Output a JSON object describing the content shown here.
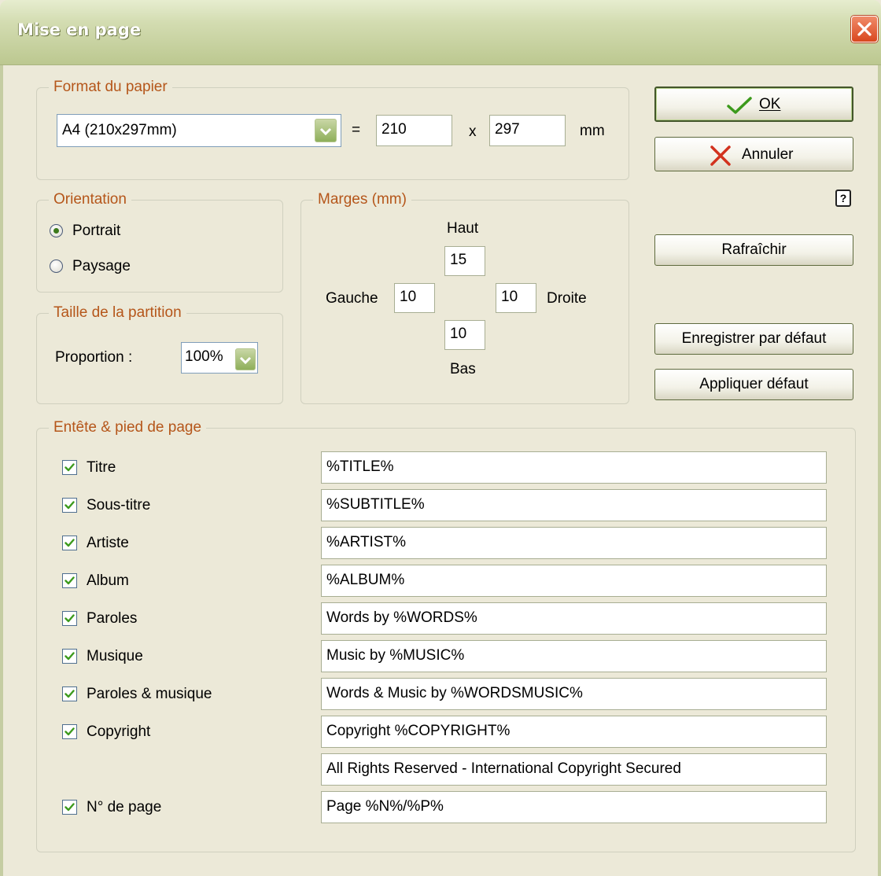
{
  "window": {
    "title": "Mise en page"
  },
  "paper": {
    "group_label": "Format du papier",
    "format_value": "A4 (210x297mm)",
    "equals": "=",
    "width": "210",
    "times": "x",
    "height": "297",
    "unit": "mm"
  },
  "orientation": {
    "group_label": "Orientation",
    "portrait_label": "Portrait",
    "landscape_label": "Paysage",
    "selected": "Portrait"
  },
  "score_size": {
    "group_label": "Taille de la partition",
    "proportion_label": "Proportion :",
    "proportion_value": "100%"
  },
  "margins": {
    "group_label": "Marges (mm)",
    "top_label": "Haut",
    "top": "15",
    "left_label": "Gauche",
    "left": "10",
    "right": "10",
    "right_label": "Droite",
    "bottom": "10",
    "bottom_label": "Bas"
  },
  "buttons": {
    "ok_label": "OK",
    "cancel_label": "Annuler",
    "help": "?",
    "refresh_label": "Rafraîchir",
    "save_default_label": "Enregistrer par défaut",
    "apply_default_label": "Appliquer défaut"
  },
  "header_footer": {
    "group_label": "Entête & pied de page",
    "rows": [
      {
        "label": "Titre",
        "checked": true,
        "value": "%TITLE%"
      },
      {
        "label": "Sous-titre",
        "checked": true,
        "value": "%SUBTITLE%"
      },
      {
        "label": "Artiste",
        "checked": true,
        "value": "%ARTIST%"
      },
      {
        "label": "Album",
        "checked": true,
        "value": "%ALBUM%"
      },
      {
        "label": "Paroles",
        "checked": true,
        "value": "Words by %WORDS%"
      },
      {
        "label": "Musique",
        "checked": true,
        "value": "Music by %MUSIC%"
      },
      {
        "label": "Paroles & musique",
        "checked": true,
        "value": "Words & Music by %WORDSMUSIC%"
      },
      {
        "label": "Copyright",
        "checked": true,
        "value": "Copyright %COPYRIGHT%"
      },
      {
        "label": "",
        "checked": false,
        "value": "All Rights Reserved - International Copyright Secured"
      },
      {
        "label": "N° de page",
        "checked": true,
        "value": "Page %N%/%P%"
      }
    ]
  },
  "colors": {
    "dialog_bg": "#ECE9D8",
    "group_label": "#B5561A",
    "titlebar": "#BCC890",
    "check_green": "#3C9A1C",
    "cancel_red": "#D2321E"
  }
}
